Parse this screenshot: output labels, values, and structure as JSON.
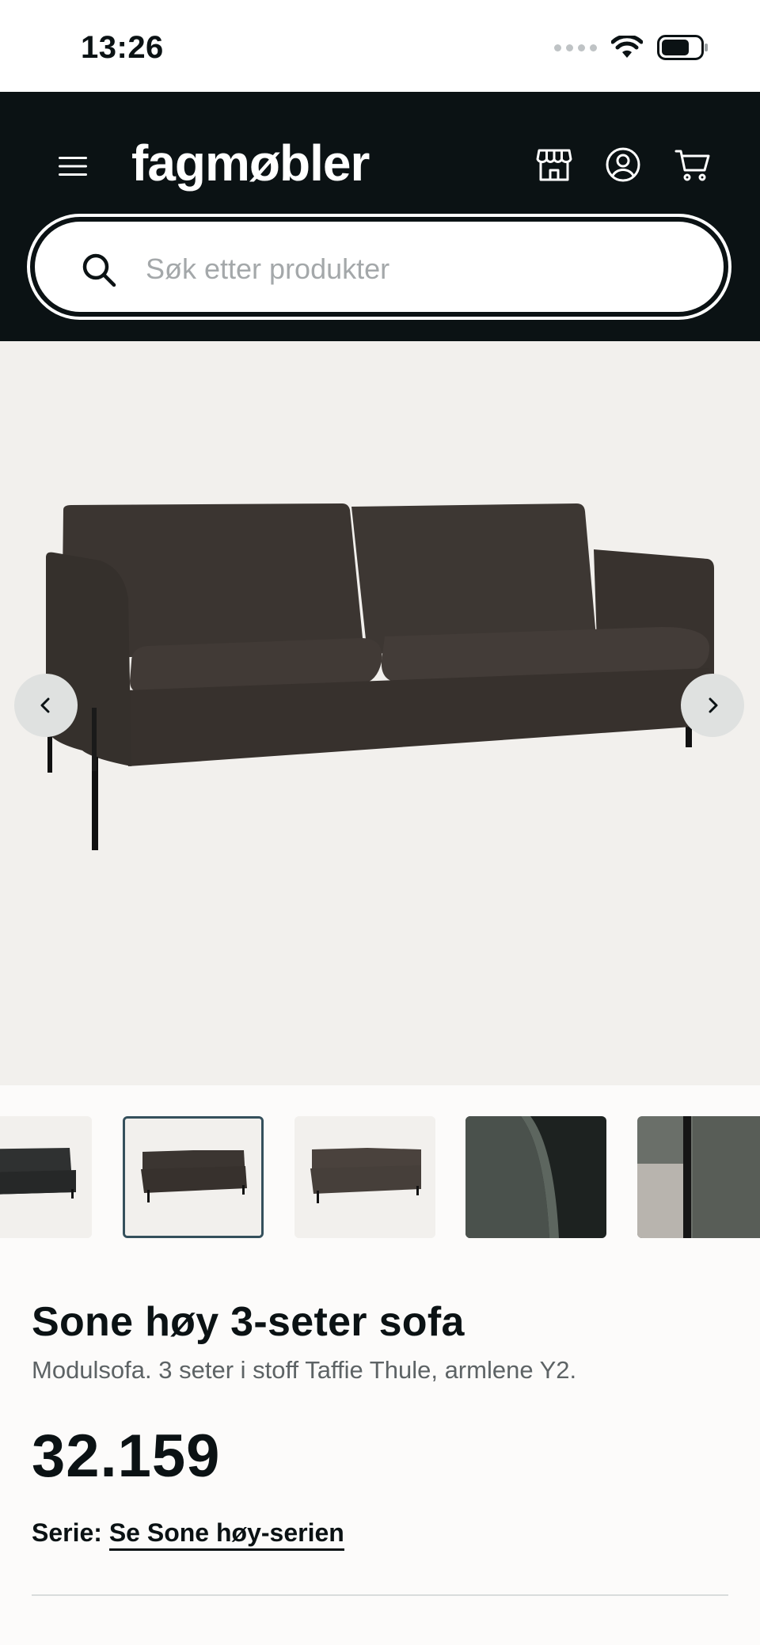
{
  "status_bar": {
    "time": "13:26"
  },
  "header": {
    "logo": "fagmøbler",
    "icons": {
      "menu": "hamburger-menu-icon",
      "store": "store-icon",
      "account": "account-icon",
      "cart": "cart-icon"
    }
  },
  "search": {
    "placeholder": "Søk etter produkter",
    "value": ""
  },
  "gallery": {
    "thumbnails": [
      {
        "name": "thumb-1",
        "active": false
      },
      {
        "name": "thumb-2",
        "active": true
      },
      {
        "name": "thumb-3",
        "active": false
      },
      {
        "name": "thumb-4",
        "active": false
      },
      {
        "name": "thumb-5",
        "active": false
      }
    ]
  },
  "product": {
    "title": "Sone høy 3-seter sofa",
    "description": "Modulsofa. 3 seter i stoff Taffie Thule, armlene Y2.",
    "price": "32.159",
    "series_label": "Serie:",
    "series_link": "Se Sone høy-serien"
  },
  "colors": {
    "header_bg": "#0b1214",
    "gallery_bg": "#f2f0ed",
    "sofa": "#3a3430",
    "accent_border": "#35505c"
  }
}
